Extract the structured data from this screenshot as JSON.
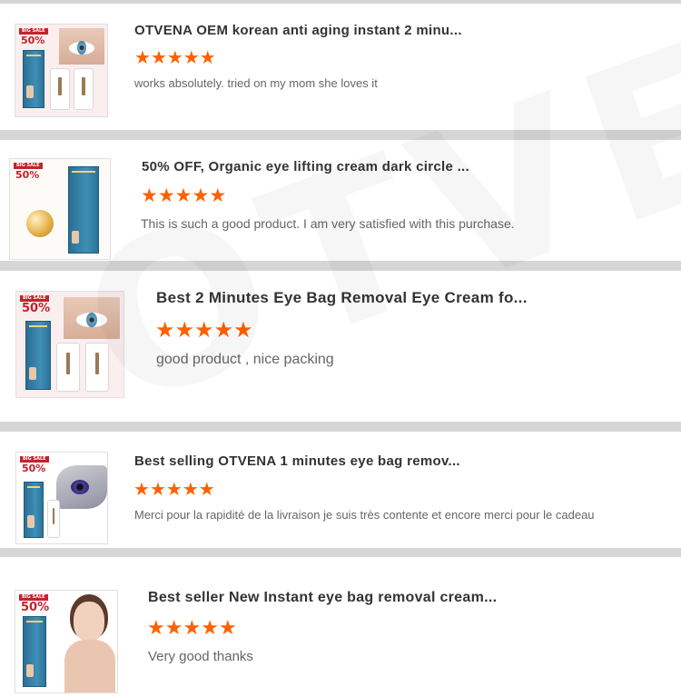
{
  "watermark": "OTVENA",
  "colors": {
    "star": "#ff6000",
    "separator": "#d6d6d6",
    "title": "#333333",
    "review": "#666666"
  },
  "reviews": [
    {
      "title": "OTVENA OEM korean anti aging instant 2 minu...",
      "rating": 5,
      "text": "works absolutely. tried on my mom she loves it",
      "thumbnail": {
        "badge": "BIG SALE",
        "discount": "50%",
        "brand": "OTVENA",
        "icon": "eye-cream-product-icon"
      }
    },
    {
      "title": "50% OFF, Organic eye lifting cream dark circle ...",
      "rating": 5,
      "text": "This is such a good product. I am very satisfied with this purchase.",
      "thumbnail": {
        "badge": "BIG SALE",
        "discount": "50%",
        "brand": "OTVENA",
        "icon": "eye-cream-product-icon"
      }
    },
    {
      "title": "Best 2 Minutes Eye Bag Removal Eye Cream fo...",
      "rating": 5,
      "text": "good product , nice packing",
      "thumbnail": {
        "badge": "BIG SALE",
        "discount": "50%",
        "brand": "OTVENA",
        "icon": "eye-cream-product-icon"
      }
    },
    {
      "title": "Best selling OTVENA 1 minutes eye bag remov...",
      "rating": 5,
      "text": "Merci pour la rapidité de la livraison je suis très contente et encore merci pour le cadeau",
      "thumbnail": {
        "badge": "BIG SALE",
        "discount": "50%",
        "brand": "OTVENA",
        "icon": "eye-cream-product-icon"
      }
    },
    {
      "title": "Best seller New Instant eye bag removal cream...",
      "rating": 5,
      "text": "Very good thanks",
      "thumbnail": {
        "badge": "BIG SALE",
        "discount": "50%",
        "brand": "OTVENA",
        "icon": "eye-cream-product-icon"
      }
    }
  ]
}
